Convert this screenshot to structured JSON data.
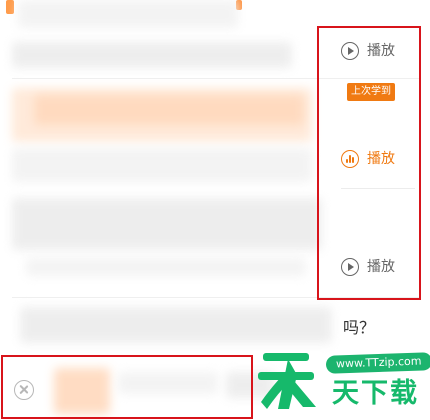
{
  "controls": {
    "items": [
      {
        "label": "播放",
        "icon": "play-icon",
        "state": "normal"
      },
      {
        "label": "播放",
        "icon": "audio-playing-icon",
        "state": "active"
      },
      {
        "label": "播放",
        "icon": "play-icon",
        "state": "normal"
      }
    ],
    "badge": "上次学到"
  },
  "content": {
    "question_suffix": "吗？"
  },
  "watermark": {
    "url": "www.TTzip.com",
    "text": "天下载"
  },
  "colors": {
    "annotation": "#d8141b",
    "accent": "#f07a12",
    "muted": "#666666",
    "logo_green": "#16b96b"
  }
}
